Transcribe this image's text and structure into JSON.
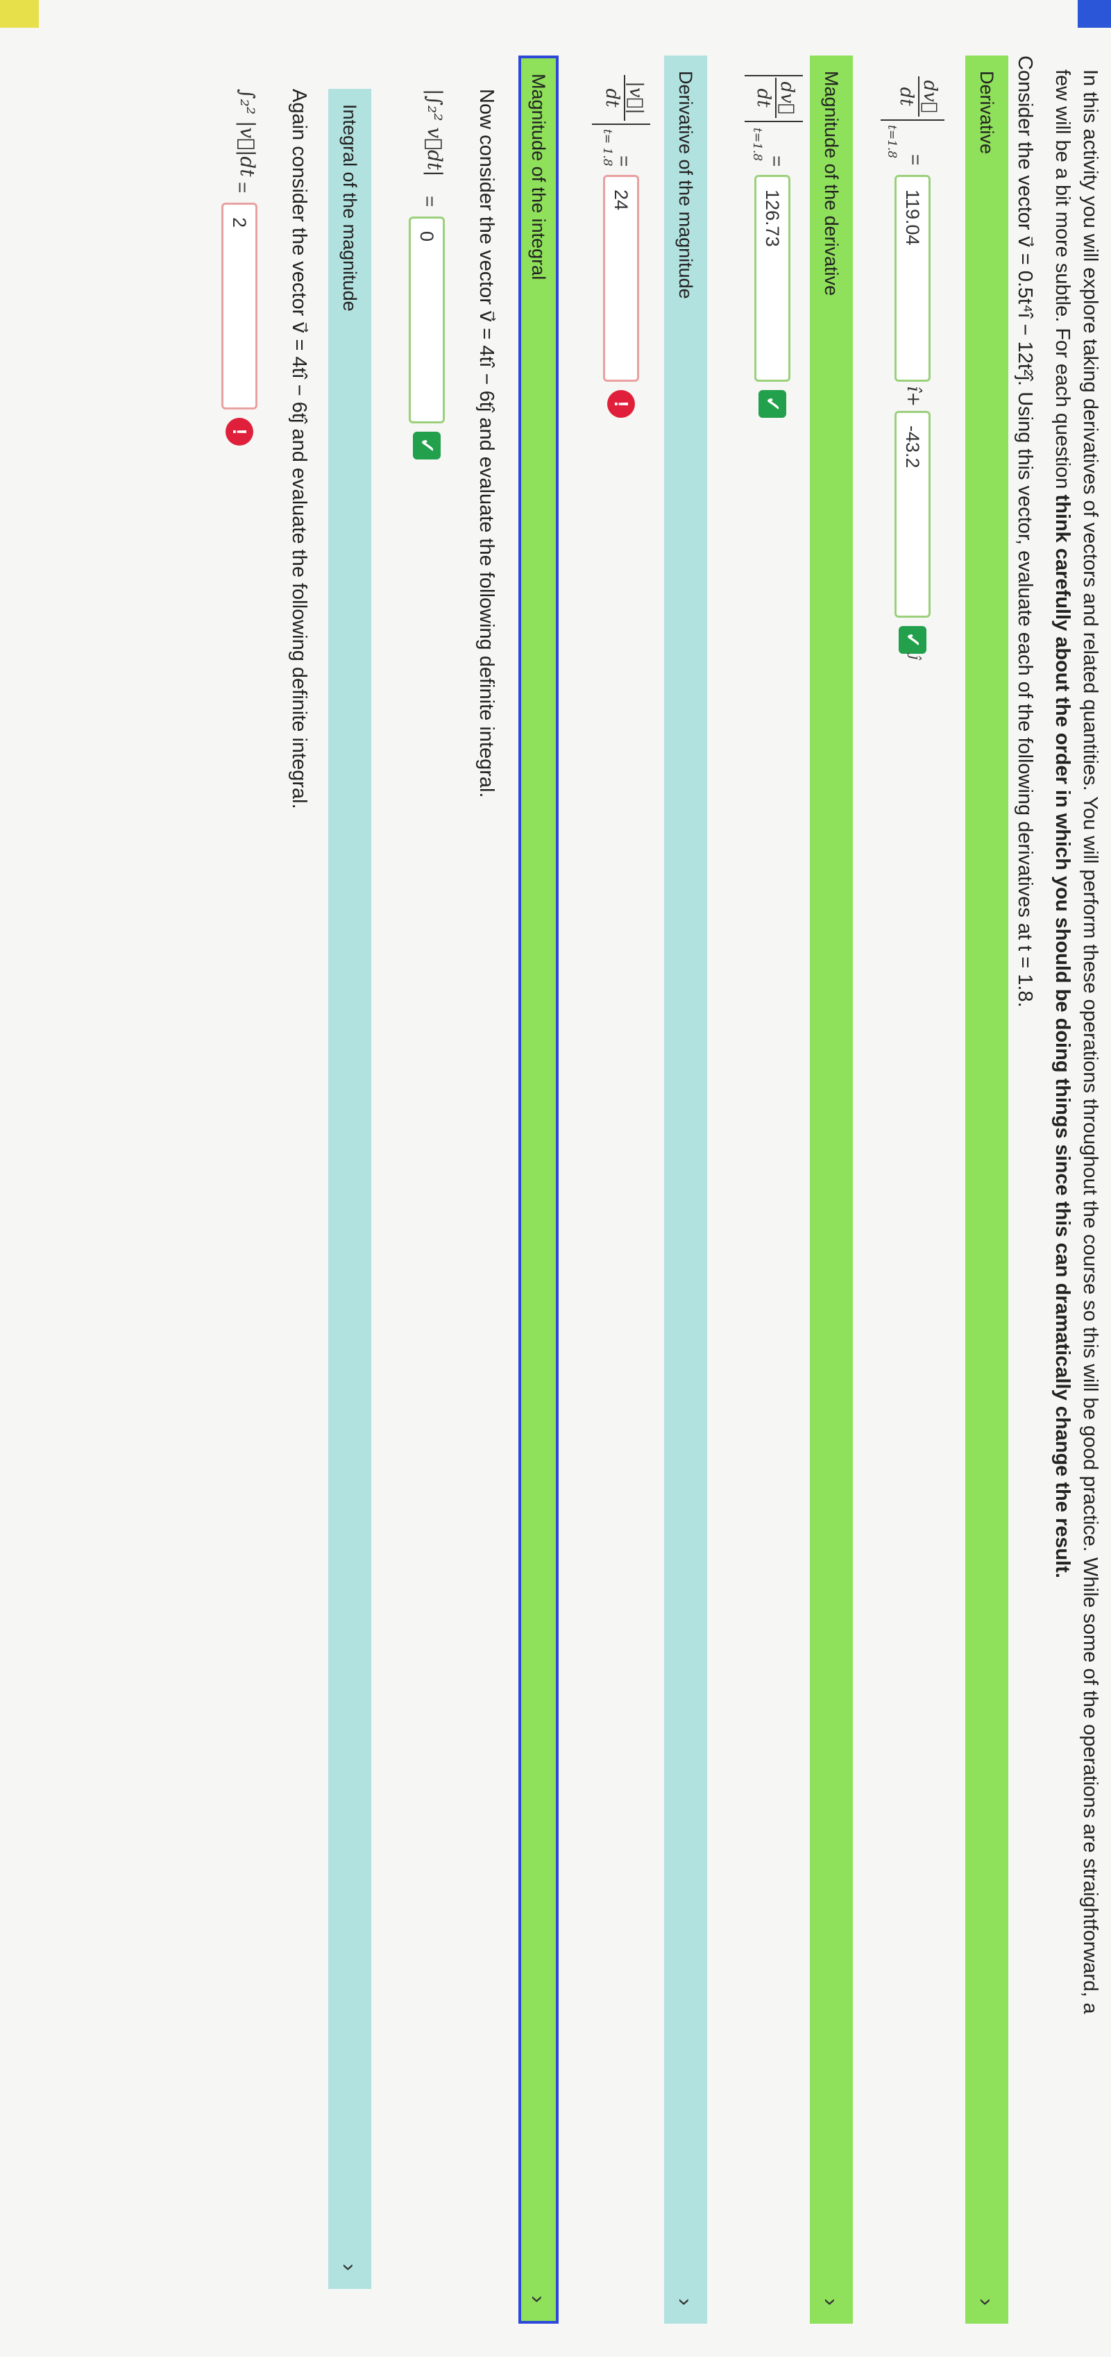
{
  "intro": {
    "line1": "In this activity you will explore taking derivatives of vectors and related quantities. You will perform these operations throughout the course so this will be good practice. While some of the operations are straightforward, a",
    "line2_plain": "few will be a bit more subtle. For each question ",
    "line2_bold": "think carefully about the order in which you should be doing things since this can dramatically change the result.",
    "line3": "Consider the vector v⃗ = 0.5t⁴î − 12t²ĵ. Using this vector, evaluate each of the following derivatives at t = 1.8."
  },
  "sections": {
    "derivative": "Derivative",
    "magnitude_of_derivative": "Magnitude of the derivative",
    "derivative_of_magnitude": "Derivative of the magnitude",
    "magnitude_of_integral": "Magnitude of the integral",
    "integral_of_magnitude": "Integral of the magnitude"
  },
  "math": {
    "dv": "dv⃗",
    "dt": "dt",
    "abs_dv": "|v⃗|",
    "at_t": "t=1.8",
    "at_t2": "t= 1.8",
    "equals": "=",
    "i_plus": "î+",
    "j_hat": "ĵ",
    "int_vdt": "∫₂² v⃗dt",
    "int_absv": "∫₂² |v⃗|dt"
  },
  "answers": {
    "deriv_i": "119.04",
    "deriv_j": "-43.2",
    "mag_deriv": "126.73",
    "deriv_mag": "24",
    "mag_int": "0",
    "int_mag": "2"
  },
  "text": {
    "now_consider": "Now consider the vector v⃗ = 4tî − 6tĵ and evaluate the following definite integral.",
    "again_consider": "Again consider the vector v⃗ = 4tî − 6tĵ and evaluate the following definite integral."
  },
  "icons": {
    "chevron": "›",
    "check": "✓",
    "alert": "!"
  },
  "colors": {
    "correct_green": "#22a04b",
    "error_red": "#e0203a",
    "section_green": "#8fe05a",
    "section_teal": "#b2e2df",
    "active_outline": "#2e49d9"
  }
}
